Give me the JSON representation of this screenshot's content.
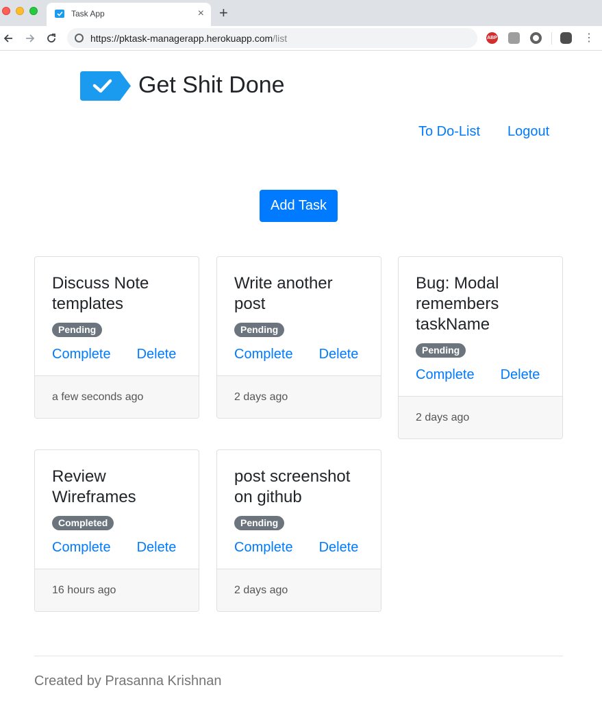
{
  "browser": {
    "tab_title": "Task App",
    "tab_close": "×",
    "new_tab": "+",
    "url_host": "https://pktask-managerapp.herokuapp.com",
    "url_path": "/list",
    "abp_label": "ABP",
    "icons": [
      "back-arrow-icon",
      "forward-arrow-icon",
      "reload-icon",
      "site-info-icon",
      "adblock-icon",
      "bug-icon",
      "circle-extension-icon",
      "profile-avatar-icon",
      "more-menu-icon"
    ]
  },
  "header": {
    "brand_title": "Get Shit Done",
    "nav": [
      {
        "label": "To Do-List"
      },
      {
        "label": "Logout"
      }
    ]
  },
  "add_task_label": "Add Task",
  "colors": {
    "primary": "#007bff",
    "badge": "#6c757d",
    "logo": "#1a9bef"
  },
  "tasks": [
    {
      "title": "Discuss Note templates",
      "status": "Pending",
      "complete": "Complete",
      "delete": "Delete",
      "time": "a few seconds ago"
    },
    {
      "title": "Write another post",
      "status": "Pending",
      "complete": "Complete",
      "delete": "Delete",
      "time": "2 days ago"
    },
    {
      "title": "Bug: Modal remembers taskName",
      "status": "Pending",
      "complete": "Complete",
      "delete": "Delete",
      "time": "2 days ago"
    },
    {
      "title": "Review Wireframes",
      "status": "Completed",
      "complete": "Complete",
      "delete": "Delete",
      "time": "16 hours ago"
    },
    {
      "title": "post screenshot on github",
      "status": "Pending",
      "complete": "Complete",
      "delete": "Delete",
      "time": "2 days ago"
    }
  ],
  "footer": {
    "text": "Created by Prasanna Krishnan"
  }
}
